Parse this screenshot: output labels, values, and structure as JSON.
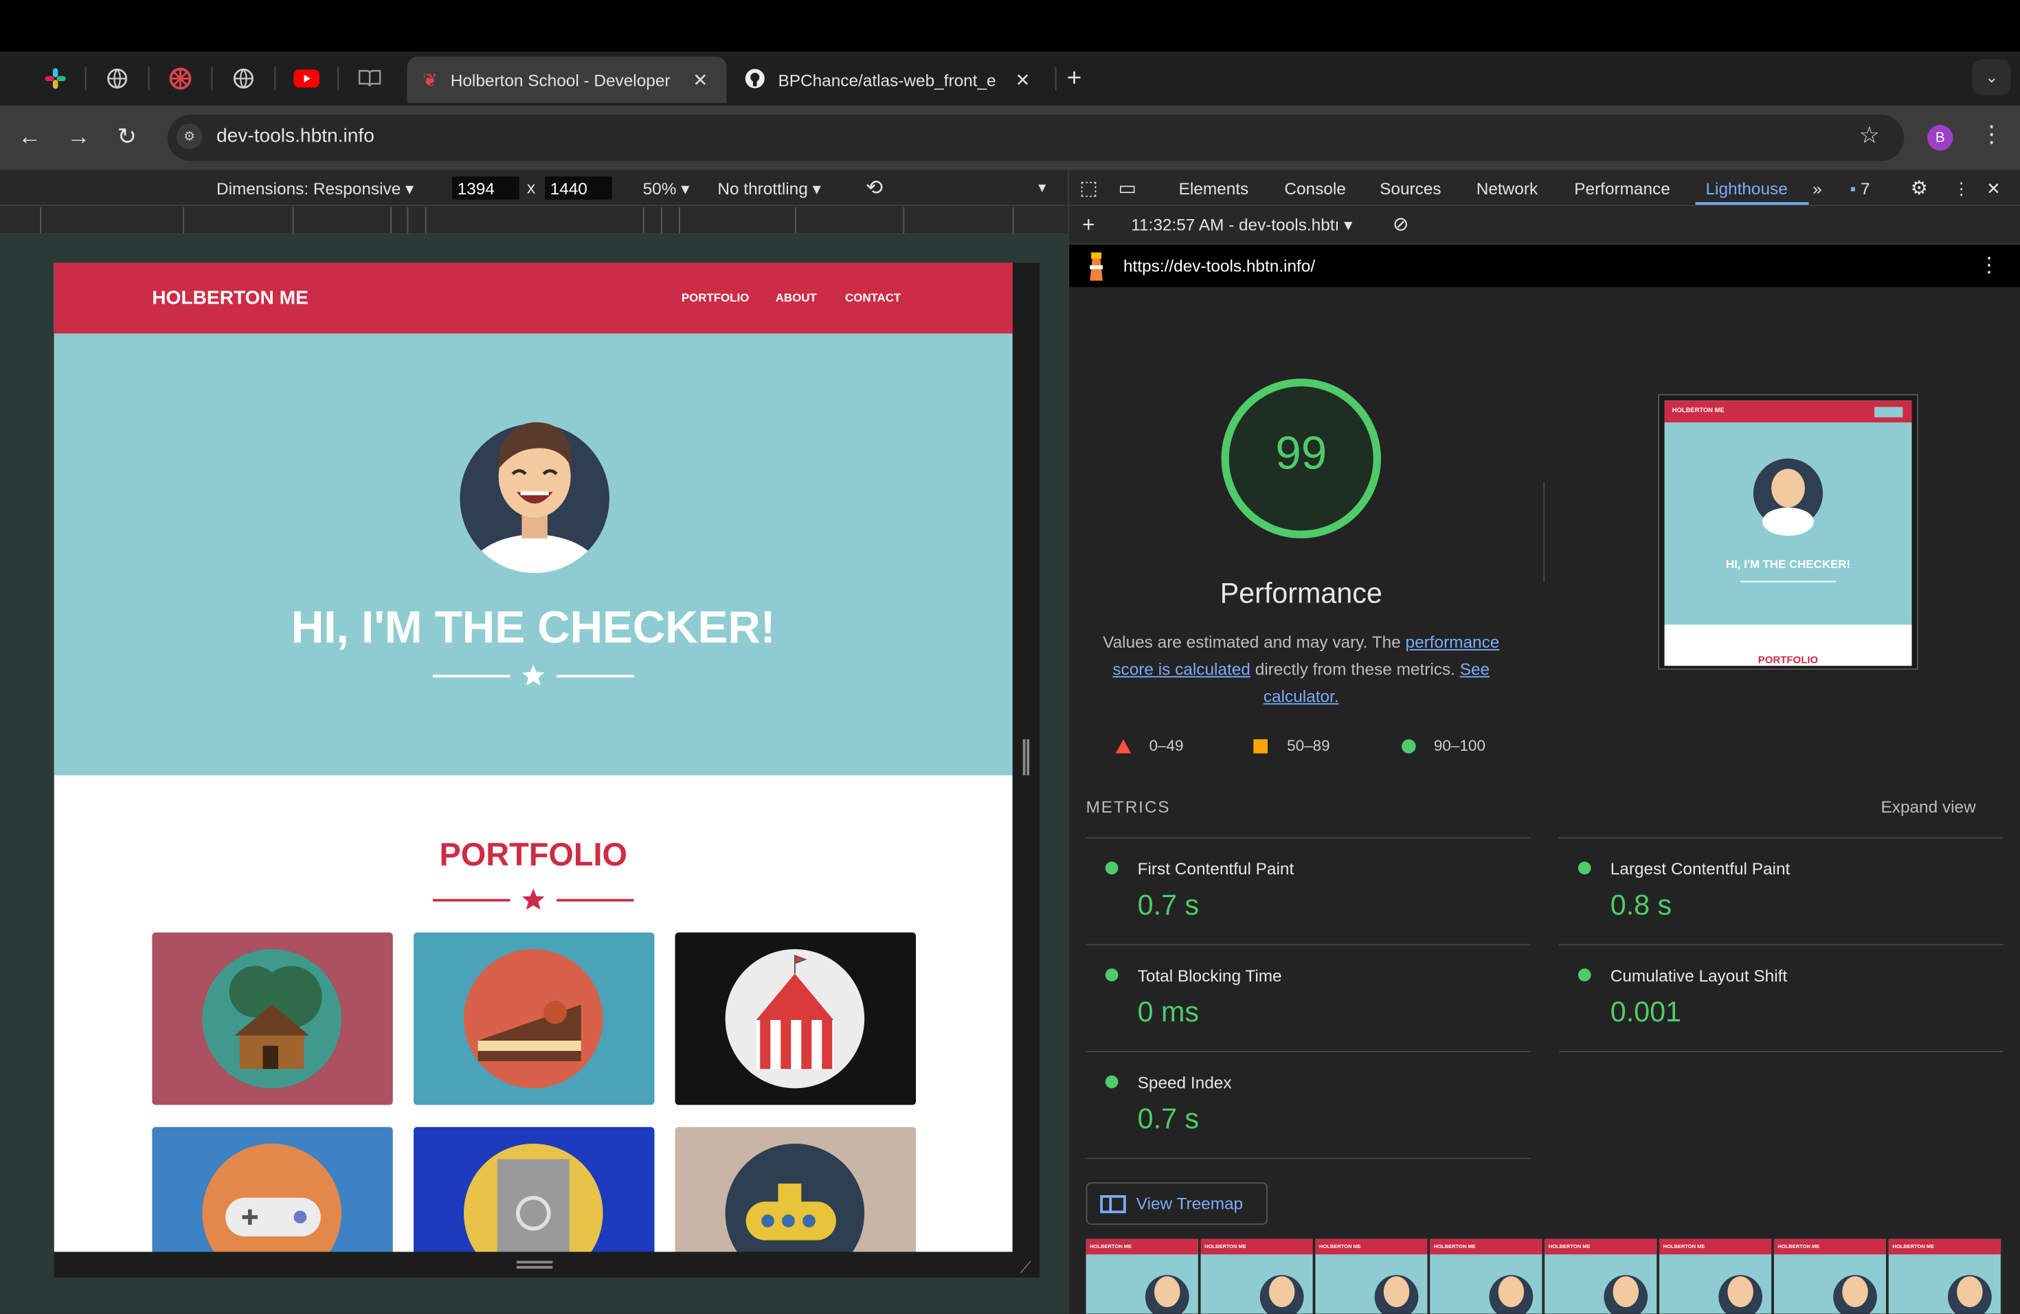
{
  "browser": {
    "tabs": [
      {
        "label": "Holberton School - Developer",
        "active": true
      },
      {
        "label": "BPChance/atlas-web_front_e",
        "active": false
      }
    ],
    "url": "dev-tools.hbtn.info",
    "profile_initial": "B"
  },
  "device_toolbar": {
    "dimensions_label": "Dimensions: Responsive",
    "width": "1394",
    "times": "x",
    "height": "1440",
    "zoom": "50%",
    "throttle": "No throttling"
  },
  "emulated_page": {
    "brand": "HOLBERTON ME",
    "nav": [
      "PORTFOLIO",
      "ABOUT",
      "CONTACT"
    ],
    "hero_title": "HI, I'M THE CHECKER!",
    "section_title": "PORTFOLIO",
    "cards": [
      {
        "name": "cabin",
        "bg": "#ab5160"
      },
      {
        "name": "cake",
        "bg": "#4aa3b8"
      },
      {
        "name": "circus",
        "bg": "#131313"
      },
      {
        "name": "controller",
        "bg": "#3d82c4"
      },
      {
        "name": "safe",
        "bg": "#1c3bbd"
      },
      {
        "name": "submarine",
        "bg": "#c9b5a6"
      }
    ]
  },
  "devtools": {
    "tabs": [
      "Elements",
      "Console",
      "Sources",
      "Network",
      "Performance",
      "Lighthouse"
    ],
    "active_tab": "Lighthouse",
    "issues_count": "7",
    "report_label": "11:32:57 AM - dev-tools.hbtı",
    "report_url": "https://dev-tools.hbtn.info/"
  },
  "lighthouse": {
    "score": "99",
    "category": "Performance",
    "desc_1": "Values are estimated and may vary. The",
    "desc_link_1": "performance score is calculated",
    "desc_2": "directly from these metrics.",
    "desc_link_2": "See calculator.",
    "legend": [
      "0–49",
      "50–89",
      "90–100"
    ],
    "metrics_heading": "METRICS",
    "expand_label": "Expand view",
    "metrics": [
      {
        "label": "First Contentful Paint",
        "value": "0.7 s"
      },
      {
        "label": "Largest Contentful Paint",
        "value": "0.8 s"
      },
      {
        "label": "Total Blocking Time",
        "value": "0 ms"
      },
      {
        "label": "Cumulative Layout Shift",
        "value": "0.001"
      },
      {
        "label": "Speed Index",
        "value": "0.7 s"
      }
    ],
    "treemap_label": "View Treemap",
    "screenshot": {
      "brand": "HOLBERTON ME",
      "title": "HI, I'M THE CHECKER!",
      "section": "PORTFOLIO"
    },
    "filmstrip_brand": "HOLBERTON ME"
  },
  "colors": {
    "pass": "#4fcb6a",
    "average": "#ffa400",
    "fail": "#ff4e42",
    "brand_red": "#cd2c46",
    "hero_teal": "#8fccd1"
  }
}
